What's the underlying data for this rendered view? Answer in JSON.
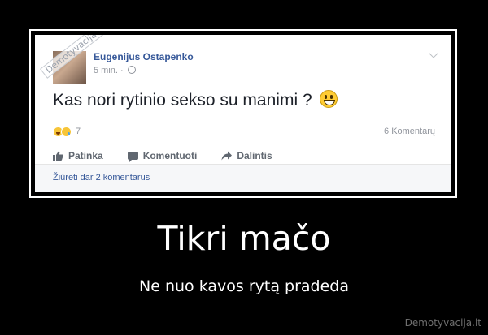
{
  "post": {
    "author": "Eugenijus Ostapenko",
    "time": "5 min. ·",
    "text": "Kas nori rytinio sekso su manimi ?",
    "reaction_count": "7",
    "comments_count": "6 Komentarų",
    "actions": {
      "like": "Patinka",
      "comment": "Komentuoti",
      "share": "Dalintis"
    },
    "view_more": "Žiūrėti dar 2 komentarus",
    "watermark": "Demotyvacija.lt"
  },
  "poster": {
    "title": "Tikri mačo",
    "subtitle": "Ne nuo kavos rytą pradeda",
    "site": "Demotyvacija.lt"
  },
  "colors": {
    "background": "#000000",
    "link_blue": "#365899",
    "meta_gray": "#90949c"
  }
}
